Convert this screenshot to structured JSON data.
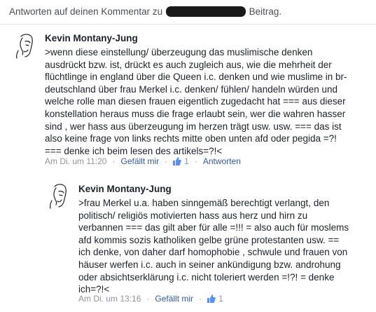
{
  "header": {
    "prefix": "Antworten auf deinen Kommentar zu",
    "suffix": "Beitrag."
  },
  "comments": [
    {
      "author": "Kevin Montany-Jung",
      "text": ">wenn diese einstellung/ überzeugung das muslimische denken\nausdrückt bzw. ist, drückt es auch zugleich aus, wie die mehrheit der\nflüchtlinge in england über die Queen i.c. denken und wie muslime in br-\ndeutschland über frau Merkel i.c. denken/ fühlen/ handeln würden und\nwelche rolle man diesen frauen eigentlich zugedacht hat === aus dieser\nkonstellation heraus muss die frage erlaubt sein,  wer die wahren hasser\nsind , wer hass aus überzeugung im herzen trägt usw. usw. === das ist\nalso keine frage von links rechts mitte oben unten afd oder pegida =?!\n=== denke ich beim lesen des artikels=?!<",
      "time": "Am Di. um 11:20",
      "like": "Gefällt mir",
      "likes": "1",
      "reply": "Antworten"
    },
    {
      "author": "Kevin Montany-Jung",
      "text": ">frau Merkel u.a. haben sinngemäß berechtigt verlangt, den\npolitisch/  religiös motivierten hass aus herz und hirn zu\nverbannen === das gilt aber für alle =!!! = also auch für moslems\nafd kommis sozis katholiken gelbe grüne protestanten  usw. ==\nich denke, von daher darf homophobie , schwule und frauen von\nhäuser werfen  i.c. auch in seiner ankündigung bzw. androhung\noder absichtserklärung i.c. nicht toleriert werden =!?! = denke\nich=?!<",
      "time": "Am Di. um 13:16",
      "like": "Gefällt mir",
      "likes": "1"
    }
  ]
}
